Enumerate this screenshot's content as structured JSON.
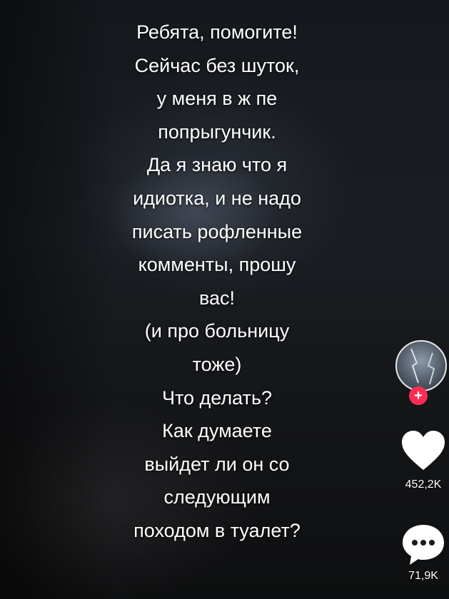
{
  "caption": {
    "lines": [
      "Ребята, помогите!",
      "Сейчас без шуток,",
      "у меня в ж пе",
      "попрыгунчик.",
      "Да я знаю что я",
      "идиотка,  и не надо",
      "писать рофленные",
      "комменты, прошу",
      "вас!",
      "(и про больницу",
      "тоже)",
      "Что делать?",
      "Как думаете",
      "выйдет ли он со",
      "следующим",
      "походом в туалет?"
    ]
  },
  "sidebar": {
    "avatar_icon": "user-avatar",
    "follow_badge": "+",
    "like_icon": "heart-icon",
    "like_count": "452,2K",
    "comment_icon": "comment-bubble-icon",
    "comment_count": "71,9K"
  },
  "colors": {
    "accent": "#fe2c55",
    "text": "#ffffff"
  }
}
